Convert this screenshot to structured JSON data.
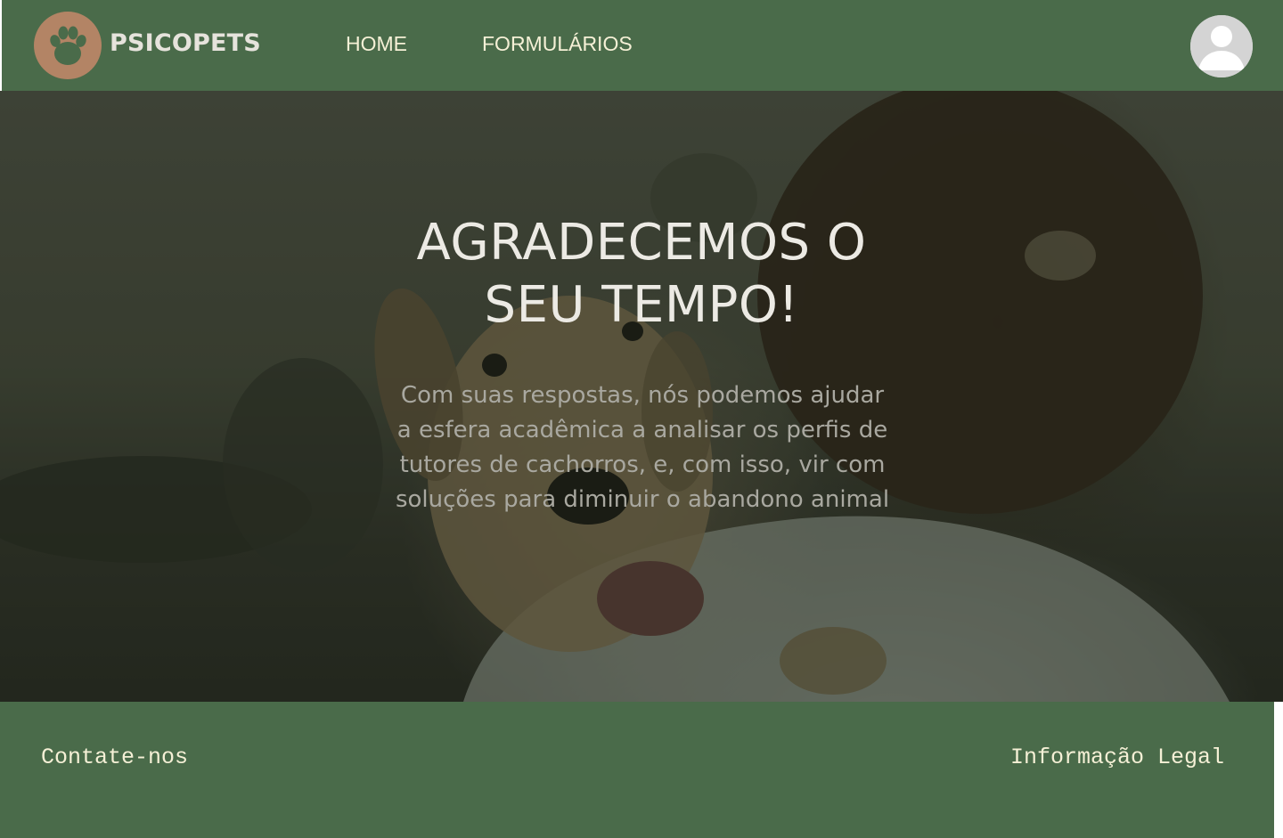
{
  "header": {
    "brand": "PSICOPETS",
    "nav": [
      {
        "label": "HOME"
      },
      {
        "label": "FORMULÁRIOS"
      }
    ],
    "logo_icon": "paw-icon",
    "avatar_icon": "user-avatar-icon"
  },
  "hero": {
    "title": "AGRADECEMOS O SEU TEMPO!",
    "message": "Com suas respostas, nós podemos ajudar a esfera acadêmica a analisar os perfis de tutores de cachorros, e, com isso, vir com soluções para diminuir o abandono animal",
    "background_image": "photo of a boy hugging a puppy"
  },
  "footer": {
    "contact": "Contate-nos",
    "legal": "Informação Legal"
  },
  "colors": {
    "primary_green": "#4a6b4a",
    "logo_brown": "#b38465",
    "nav_text": "#f5f0d6"
  }
}
